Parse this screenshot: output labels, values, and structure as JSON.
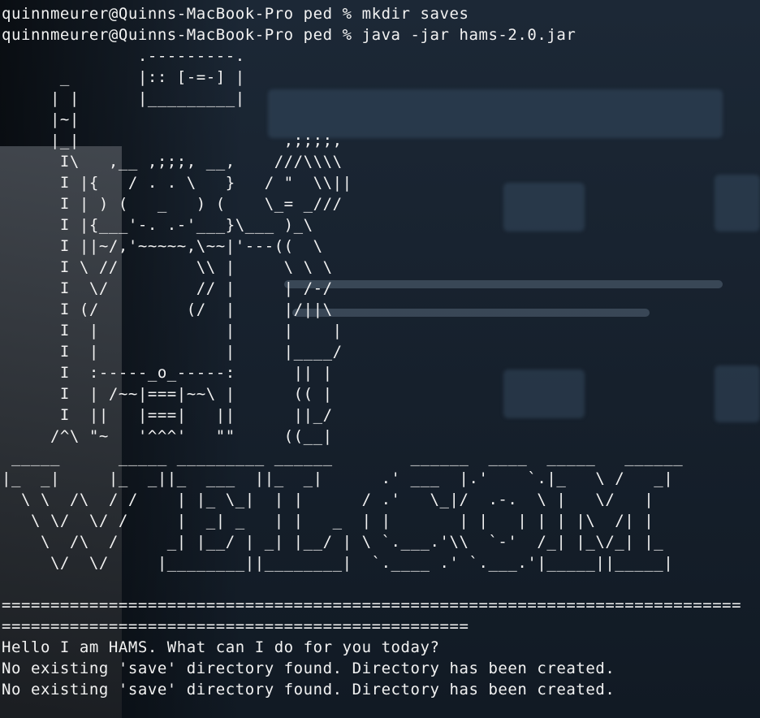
{
  "theme": {
    "text_color": "#f2f2f2",
    "background_color": "#18222e"
  },
  "terminal": {
    "prompt_1": "quinnmeurer@Quinns-MacBook-Pro ped % mkdir saves",
    "prompt_2": "quinnmeurer@Quinns-MacBook-Pro ped % java -jar hams-2.0.jar",
    "art": [
      "              .---------.",
      "      _       |:: [-=-] |",
      "     | |      |_________|",
      "     |~|",
      "     |_|                     ,;;;;,",
      "      I\\   ,__ ,;;;, __,    ///\\\\\\\\",
      "      I |{   / . . \\   }   / \"  \\\\||",
      "      I | ) (   _   ) (    \\_= _///",
      "      I |{___'-. .-'___}\\___ )_\\",
      "      I ||~/,'~~~~~,\\~~|'---((  \\",
      "      I \\ //        \\\\ |     \\ \\ \\",
      "      I  \\/         // |     | /-/",
      "      I (/         (/  |     |/||\\",
      "      I  |             |     |    |",
      "      I  |             |     |____/",
      "      I  :-----_o_-----:      || |",
      "      I  | /~~|===|~~\\ |      (( |",
      "      I  ||   |===|   ||      ||_/",
      "     /^\\ \"~   '^^^'   \"\"     ((__|"
    ],
    "banner": [
      " _____      _____ _________ ______        ______  ____  _____   ______",
      "|_  _|     |_  _||_  ___  ||_  _|      .' ___  |.'    `.|_   \\ /   _|",
      "  \\ \\  /\\  / /    | |_ \\_|  | |      / .'   \\_|/  .-.  \\ |   \\/   |",
      "   \\ \\/  \\/ /     |  _| _   | |   _  | |       | |   | | | |\\  /| |",
      "    \\  /\\  /     _| |__/ | _| |__/ | \\ `.___.'\\\\  `-'  /_| |_\\/_| |_",
      "     \\/  \\/     |________||________|  `.____ .' `.___.'|_____||_____|"
    ],
    "divider_1": "============================================================================",
    "divider_2": "================================================",
    "output_1": "Hello I am HAMS. What can I do for you today?",
    "output_2": "No existing 'save' directory found. Directory has been created.",
    "output_3": "No existing 'save' directory found. Directory has been created."
  }
}
